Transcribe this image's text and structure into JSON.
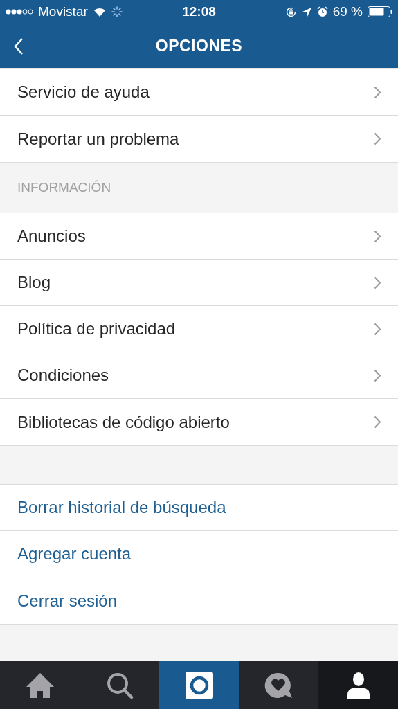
{
  "status_bar": {
    "carrier": "Movistar",
    "time": "12:08",
    "battery": "69 %"
  },
  "nav_bar": {
    "title": "OPCIONES"
  },
  "sections": [
    {
      "items": [
        {
          "label": "Servicio de ayuda",
          "kind": "link"
        },
        {
          "label": "Reportar un problema",
          "kind": "link"
        }
      ]
    },
    {
      "header": "INFORMACIÓN",
      "items": [
        {
          "label": "Anuncios",
          "kind": "link"
        },
        {
          "label": "Blog",
          "kind": "link"
        },
        {
          "label": "Política de privacidad",
          "kind": "link"
        },
        {
          "label": "Condiciones",
          "kind": "link"
        },
        {
          "label": "Bibliotecas de código abierto",
          "kind": "link"
        }
      ]
    },
    {
      "items": [
        {
          "label": "Borrar historial de búsqueda",
          "kind": "action"
        },
        {
          "label": "Agregar cuenta",
          "kind": "action"
        },
        {
          "label": "Cerrar sesión",
          "kind": "action"
        }
      ]
    }
  ],
  "tab_bar": [
    {
      "kind": "home",
      "selected": false
    },
    {
      "kind": "search",
      "selected": false
    },
    {
      "kind": "camera",
      "selected": false
    },
    {
      "kind": "activity",
      "selected": false
    },
    {
      "kind": "profile",
      "selected": true
    }
  ]
}
